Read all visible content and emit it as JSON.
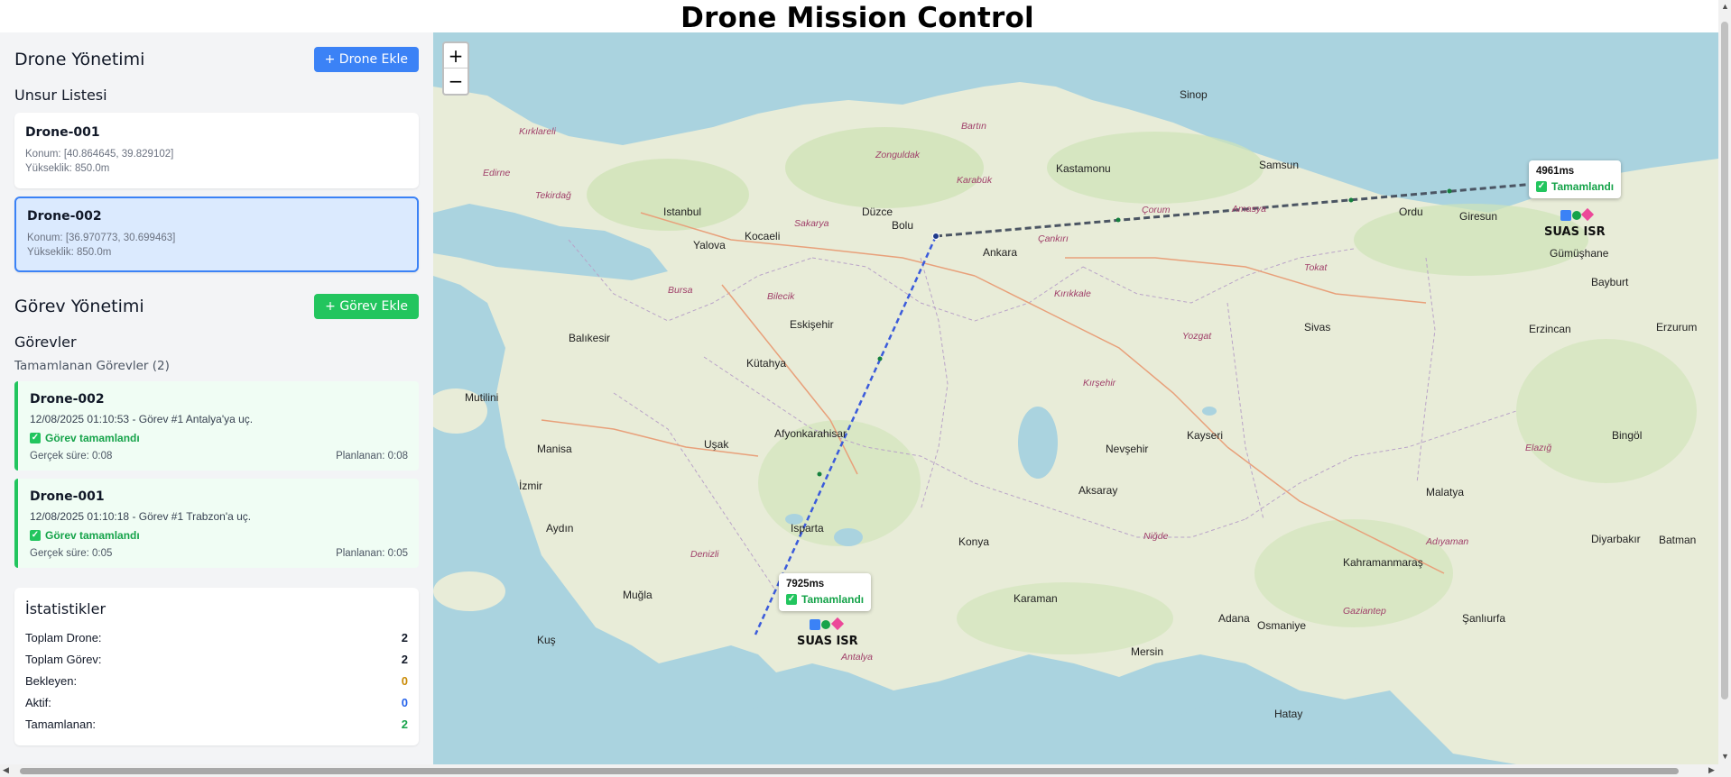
{
  "app": {
    "title": "Drone Mission Control"
  },
  "drone_section": {
    "title": "Drone Yönetimi",
    "add_button": "+ Drone Ekle",
    "list_title": "Unsur Listesi",
    "drones": [
      {
        "name": "Drone-001",
        "position": "Konum: [40.864645, 39.829102]",
        "altitude": "Yükseklik: 850.0m",
        "selected": false
      },
      {
        "name": "Drone-002",
        "position": "Konum: [36.970773, 30.699463]",
        "altitude": "Yükseklik: 850.0m",
        "selected": true
      }
    ]
  },
  "task_section": {
    "title": "Görev Yönetimi",
    "add_button": "+ Görev Ekle",
    "list_title": "Görevler",
    "completed_header": "Tamamlanan Görevler (2)",
    "tasks": [
      {
        "drone": "Drone-002",
        "desc": "12/08/2025 01:10:53 - Görev #1 Antalya'ya uç.",
        "status": "Görev tamamlandı",
        "actual": "Gerçek süre: 0:08",
        "planned": "Planlanan: 0:08"
      },
      {
        "drone": "Drone-001",
        "desc": "12/08/2025 01:10:18 - Görev #1 Trabzon'a uç.",
        "status": "Görev tamamlandı",
        "actual": "Gerçek süre: 0:05",
        "planned": "Planlanan: 0:05"
      }
    ]
  },
  "stats": {
    "title": "İstatistikler",
    "rows": [
      {
        "label": "Toplam Drone:",
        "value": "2",
        "color": "#111827"
      },
      {
        "label": "Toplam Görev:",
        "value": "2",
        "color": "#111827"
      },
      {
        "label": "Bekleyen:",
        "value": "0",
        "color": "#ca8a04"
      },
      {
        "label": "Aktif:",
        "value": "0",
        "color": "#2563eb"
      },
      {
        "label": "Tamamlanan:",
        "value": "2",
        "color": "#16a34a"
      }
    ]
  },
  "map": {
    "zoom_in": "+",
    "zoom_out": "−",
    "popups": [
      {
        "time": "4961ms",
        "status": "Tamamlandı",
        "unit_label": "SUAS ISR"
      },
      {
        "time": "7925ms",
        "status": "Tamamlandı",
        "unit_label": "SUAS ISR"
      }
    ],
    "route_colors": {
      "trabzon": "#4b5563",
      "antalya": "#3b5bdb"
    },
    "cities": [
      "Ankara",
      "Istanbul",
      "Bursa",
      "Eskişehir",
      "Kütahya",
      "Afyonkarahisar",
      "Balıkesir",
      "Manisa",
      "İzmir",
      "Aydın",
      "Denizli",
      "Isparta",
      "Muğla",
      "Antalya",
      "Konya",
      "Karaman",
      "Aksaray",
      "Nevşehir",
      "Kayseri",
      "Sivas",
      "Yozgat",
      "Kırıkkale",
      "Kırşehir",
      "Niğde",
      "Adana",
      "Mersin",
      "Osmaniye",
      "Hatay",
      "Kahramanmaraş",
      "Gaziantep",
      "Şanlıurfa",
      "Adıyaman",
      "Malatya",
      "Elazığ",
      "Bingöl",
      "Erzincan",
      "Erzurum",
      "Gümüşhane",
      "Bayburt",
      "Giresun",
      "Ordu",
      "Sinop",
      "Kastamonu",
      "Karabük",
      "Zonguldak",
      "Bartın",
      "Çankırı",
      "Çorum",
      "Amasya",
      "Tokat",
      "Samsun",
      "Düzce",
      "Bolu",
      "Sakarya",
      "Kocaeli",
      "Yalova",
      "Tekirdağ",
      "Edirne",
      "Kırklareli",
      "Bilecik",
      "Uşak",
      "Kuş",
      "Diyarbakır",
      "Batman",
      "Mutilini"
    ]
  }
}
